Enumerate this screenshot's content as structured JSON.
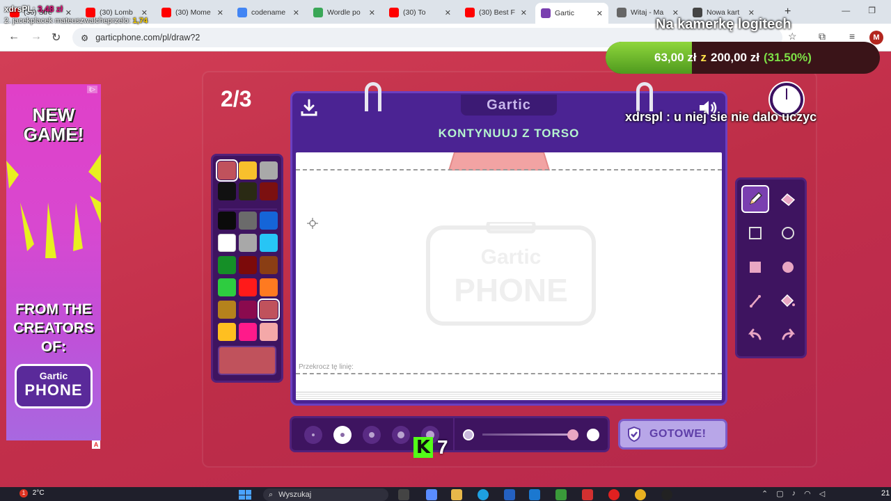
{
  "browser": {
    "tabs": [
      {
        "title": "(30) Stre",
        "icon": "youtube-icon",
        "color": "#ff0000"
      },
      {
        "title": "(30) Lomb",
        "icon": "youtube-icon",
        "color": "#ff0000"
      },
      {
        "title": "(30) Mome",
        "icon": "youtube-icon",
        "color": "#ff0000"
      },
      {
        "title": "codename",
        "icon": "google-icon",
        "color": "#4285f4"
      },
      {
        "title": "Wordle po",
        "icon": "wordle-icon",
        "color": "#3aa757"
      },
      {
        "title": "(30) To",
        "icon": "youtube-icon",
        "color": "#ff0000"
      },
      {
        "title": "(30) Best F",
        "icon": "youtube-icon",
        "color": "#ff0000"
      },
      {
        "title": "Gartic",
        "icon": "gartic-icon",
        "color": "#7a3fb0",
        "active": true
      },
      {
        "title": "Witaj - Ma",
        "icon": "mail-icon",
        "color": "#666666"
      },
      {
        "title": "Nowa kart",
        "icon": "chrome-icon",
        "color": "#444444"
      }
    ],
    "url": "garticphone.com/pl/draw?2",
    "profile_initial": "M"
  },
  "overlay": {
    "donor1_name": "xdrsPL:",
    "donor1_amount": "3,48 zł",
    "donor2_text": "2. jacekplacek mateuszwalcheprzelo:",
    "donor2_amount": "1,74",
    "webcam_label": "Na kamerkę logitech",
    "goal": {
      "current": "63,00 zł",
      "separator": "z",
      "target": "200,00 zł",
      "percent_label": "(31.50%)",
      "fraction": 0.315
    },
    "chat_user": "xdrspl",
    "chat_text": ": u niej sie nie dalo uczyc",
    "kick_letter": "K",
    "kick_count": "7"
  },
  "ad": {
    "headline": "NEW GAME!",
    "body": "FROM THE CREATORS OF:",
    "logo_top": "Gartic",
    "logo_bottom": "PHONE",
    "badge": "A",
    "info": "i▷"
  },
  "game": {
    "round": "2/3",
    "logo": "Gartic",
    "prompt": "KONTYNUUJ Z TORSO",
    "cross_line_label": "Przekrocz tę linię:",
    "watermark_top": "Gartic",
    "watermark_bottom": "PHONE",
    "done_label": "GOTOWE!",
    "timer_fraction": 0.0,
    "opacity_fraction": 0.8,
    "selected_color": "#c0525c",
    "palette": [
      [
        "#c0525c",
        "#f8c02c",
        "#a9a9a9"
      ],
      [
        "#111111",
        "#2a2a14",
        "#7c1010"
      ],
      [
        "#0b0b0b",
        "#6b6b6b",
        "#1565d8"
      ],
      [
        "#ffffff",
        "#a8a8a8",
        "#27c5f5"
      ],
      [
        "#158f27",
        "#7c0a0a",
        "#8a3e14"
      ],
      [
        "#2ecc40",
        "#ff1a1a",
        "#ff7a20"
      ],
      [
        "#b5821c",
        "#8a0a4e",
        "#c0525c"
      ],
      [
        "#ffbf20",
        "#ff1a8a",
        "#f4a8a8"
      ]
    ],
    "tools": [
      "pencil-icon",
      "eraser-icon",
      "rect-outline-icon",
      "ellipse-outline-icon",
      "rect-fill-icon",
      "ellipse-fill-icon",
      "line-icon",
      "bucket-icon",
      "undo-icon",
      "redo-icon"
    ],
    "brush_sizes": [
      1,
      2,
      3,
      4,
      5
    ],
    "selected_brush": 2
  },
  "taskbar": {
    "weather": "2°C",
    "weather_badge": "1",
    "search_placeholder": "Wyszukaj",
    "clock": "21"
  }
}
